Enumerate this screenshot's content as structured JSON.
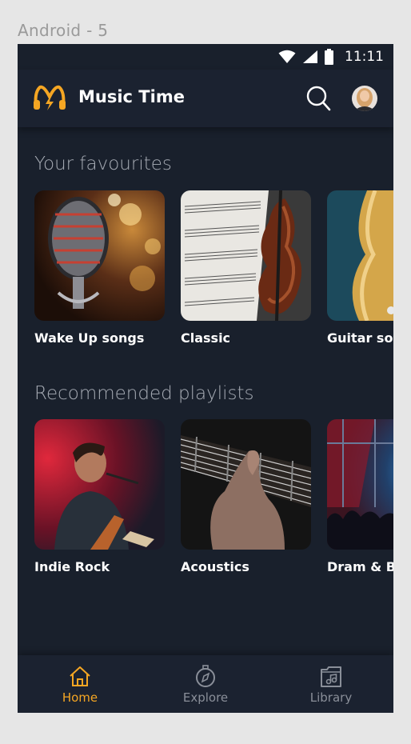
{
  "frame": {
    "label": "Android - 5"
  },
  "status_bar": {
    "time": "11:11"
  },
  "header": {
    "title": "Music Time",
    "search_icon": "search-icon",
    "avatar": "user-avatar"
  },
  "sections": {
    "favourites": {
      "title": "Your favourites",
      "items": [
        {
          "label": "Wake Up songs"
        },
        {
          "label": "Classic"
        },
        {
          "label": "Guitar sol"
        }
      ]
    },
    "recommended": {
      "title": "Recommended playlists",
      "items": [
        {
          "label": "Indie Rock"
        },
        {
          "label": "Acoustics"
        },
        {
          "label": "Dram & B"
        }
      ]
    }
  },
  "bottom_nav": {
    "items": [
      {
        "label": "Home",
        "icon": "home-icon",
        "active": true
      },
      {
        "label": "Explore",
        "icon": "compass-icon",
        "active": false
      },
      {
        "label": "Library",
        "icon": "library-icon",
        "active": false
      }
    ]
  },
  "colors": {
    "background": "#19202c",
    "bar": "#1b2230",
    "accent": "#f5a623",
    "inactive": "#8a8f99",
    "section_title": "#a7acb5"
  }
}
